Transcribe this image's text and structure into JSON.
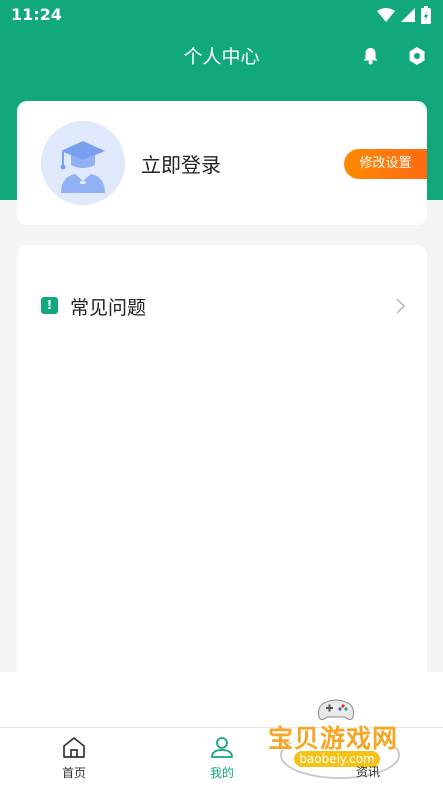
{
  "status": {
    "time": "11:24"
  },
  "header": {
    "title": "个人中心"
  },
  "profile": {
    "login_text": "立即登录",
    "settings_label": "修改设置"
  },
  "menu": {
    "items": [
      {
        "label": "常见问题",
        "badge": "!"
      }
    ]
  },
  "tabs": [
    {
      "label": "首页",
      "icon": "home-icon",
      "active": false
    },
    {
      "label": "我的",
      "icon": "user-icon",
      "active": true
    }
  ],
  "watermark": {
    "title": "宝贝游戏网",
    "url": "baobeiy.com",
    "partial_tab_label": "资讯"
  },
  "colors": {
    "primary": "#11a87c",
    "accent": "#ff7a0a",
    "background": "#f4f4f4"
  }
}
